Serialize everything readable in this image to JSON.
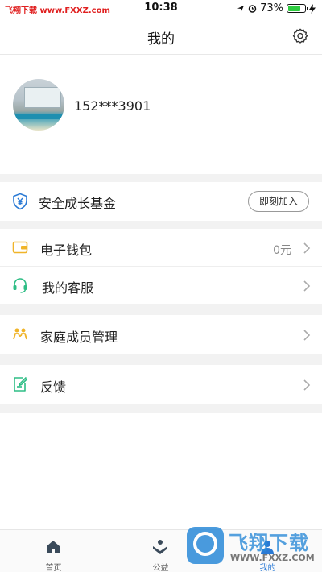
{
  "status": {
    "watermark": "飞翔下载 www.FXXZ.com",
    "time": "10:38",
    "battery_pct_label": "73%",
    "battery_level": 0.73
  },
  "nav": {
    "title": "我的",
    "settings_icon": "gear-icon"
  },
  "profile": {
    "phone": "152***3901"
  },
  "fund": {
    "label": "安全成长基金",
    "button": "即刻加入"
  },
  "menu": [
    {
      "label": "电子钱包",
      "value": "0元",
      "icon": "wallet-icon"
    },
    {
      "label": "我的客服",
      "value": "",
      "icon": "headset-icon"
    },
    {
      "label": "家庭成员管理",
      "value": "",
      "icon": "family-icon"
    },
    {
      "label": "反馈",
      "value": "",
      "icon": "feedback-icon"
    }
  ],
  "tabs": [
    {
      "label": "首页",
      "icon": "home-icon"
    },
    {
      "label": "公益",
      "icon": "charity-icon"
    },
    {
      "label": "我的",
      "icon": "user-icon",
      "active": true
    }
  ],
  "brand": {
    "name": "飞翔下载",
    "url": "WWW.FXXZ.COM"
  },
  "colors": {
    "accent": "#2a7ad5",
    "wallet": "#f0b429",
    "service": "#2ebd85",
    "fund": "#2a7ad5"
  }
}
